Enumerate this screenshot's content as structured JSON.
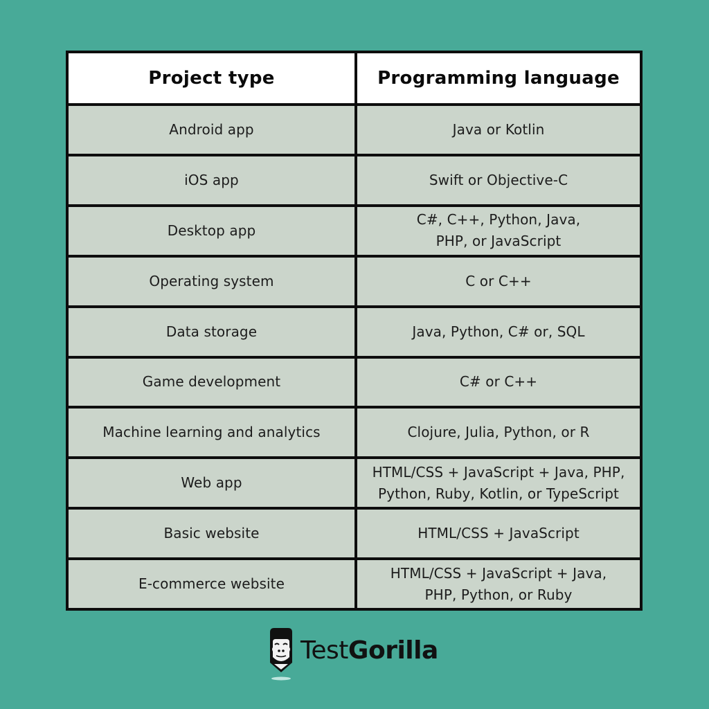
{
  "table": {
    "headers": [
      "Project type",
      "Programming language"
    ],
    "rows": [
      {
        "project_type": "Android app",
        "language": "Java or Kotlin"
      },
      {
        "project_type": "iOS app",
        "language": "Swift or Objective-C"
      },
      {
        "project_type": "Desktop app",
        "language": "C#, C++, Python, Java,\nPHP, or JavaScript"
      },
      {
        "project_type": "Operating system",
        "language": "C or C++"
      },
      {
        "project_type": "Data storage",
        "language": "Java, Python, C# or, SQL"
      },
      {
        "project_type": "Game development",
        "language": "C# or C++"
      },
      {
        "project_type": "Machine learning and analytics",
        "language": "Clojure, Julia, Python, or R"
      },
      {
        "project_type": "Web app",
        "language": "HTML/CSS + JavaScript + Java, PHP,\nPython, Ruby, Kotlin, or TypeScript"
      },
      {
        "project_type": "Basic website",
        "language": "HTML/CSS + JavaScript"
      },
      {
        "project_type": "E-commerce website",
        "language": "HTML/CSS + JavaScript + Java,\nPHP, Python, or Ruby"
      }
    ]
  },
  "brand": {
    "name_light": "Test",
    "name_bold": "Gorilla",
    "icon": "gorilla-pencil-logo-icon"
  },
  "colors": {
    "background": "#48aa98",
    "header_bg": "#ffffff",
    "row_bg": "#cbd5cb",
    "border": "#0d0d0d"
  }
}
